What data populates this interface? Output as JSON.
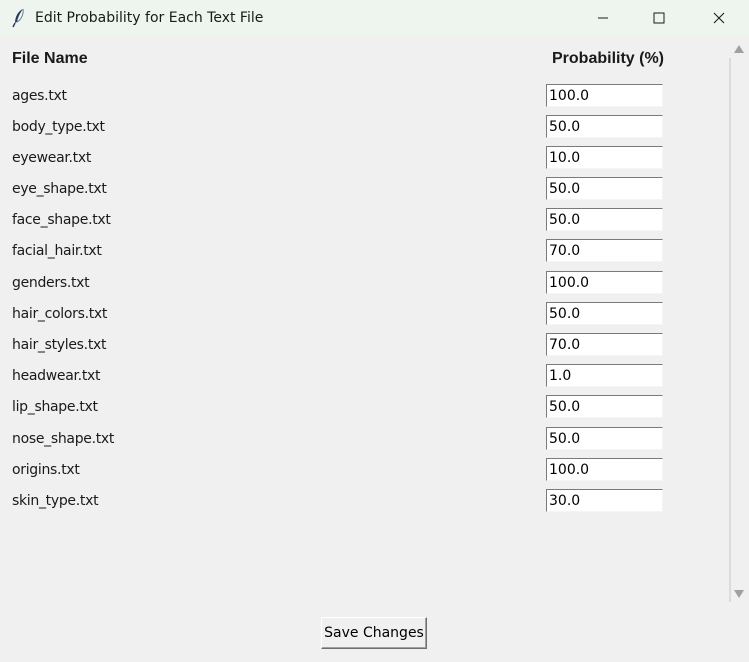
{
  "window": {
    "title": "Edit Probability for Each Text File",
    "icon": "feather-icon",
    "controls": [
      "minimize-icon",
      "maximize-icon",
      "close-icon"
    ]
  },
  "table": {
    "headers": {
      "file_name": "File Name",
      "probability": "Probability (%)"
    },
    "rows": [
      {
        "file": "ages.txt",
        "value": "100.0"
      },
      {
        "file": "body_type.txt",
        "value": "50.0"
      },
      {
        "file": "eyewear.txt",
        "value": "10.0"
      },
      {
        "file": "eye_shape.txt",
        "value": "50.0"
      },
      {
        "file": "face_shape.txt",
        "value": "50.0"
      },
      {
        "file": "facial_hair.txt",
        "value": "70.0"
      },
      {
        "file": "genders.txt",
        "value": "100.0"
      },
      {
        "file": "hair_colors.txt",
        "value": "50.0"
      },
      {
        "file": "hair_styles.txt",
        "value": "70.0"
      },
      {
        "file": "headwear.txt",
        "value": "1.0"
      },
      {
        "file": "lip_shape.txt",
        "value": "50.0"
      },
      {
        "file": "nose_shape.txt",
        "value": "50.0"
      },
      {
        "file": "origins.txt",
        "value": "100.0"
      },
      {
        "file": "skin_type.txt",
        "value": "30.0"
      }
    ]
  },
  "actions": {
    "save_label": "Save Changes"
  }
}
